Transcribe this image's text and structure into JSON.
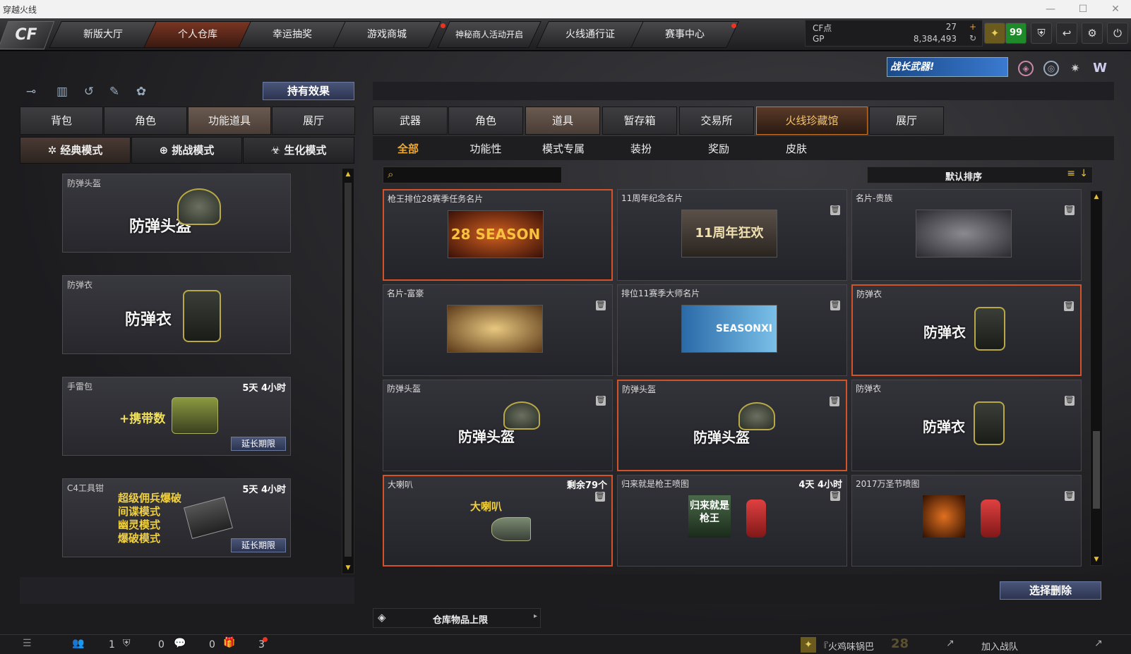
{
  "window": {
    "title": "穿越火线",
    "minimize": "—",
    "maximize": "☐",
    "close": "✕"
  },
  "nav": {
    "logo": "CF",
    "tabs": [
      "新版大厅",
      "个人仓库",
      "幸运抽奖",
      "游戏商城",
      "神秘商人活动开启",
      "火线通行证",
      "赛事中心"
    ],
    "active": "个人仓库"
  },
  "currency": {
    "cf_label": "CF点",
    "cf_value": "27",
    "gp_label": "GP",
    "gp_value": "8,384,493",
    "level": "99"
  },
  "banner": {
    "text": "战长武器!"
  },
  "left": {
    "effect_button": "持有效果",
    "tabs": [
      "背包",
      "角色",
      "功能道具",
      "展厅"
    ],
    "active_tab": "功能道具",
    "modes": [
      "经典模式",
      "挑战模式",
      "生化模式"
    ],
    "active_mode": "经典模式",
    "items": [
      {
        "name": "防弹头盔",
        "big": "防弹头盔",
        "time": "",
        "extend": ""
      },
      {
        "name": "防弹衣",
        "big": "防弹衣",
        "time": "",
        "extend": ""
      },
      {
        "name": "手雷包",
        "big": "+携带数",
        "time": "5天 4小时",
        "extend": "延长期限"
      },
      {
        "name": "C4工具钳",
        "big": "超级佣兵爆破\n间谍模式\n幽灵模式\n爆破模式",
        "time": "5天 4小时",
        "extend": "延长期限"
      }
    ],
    "c4_lines": [
      "超级佣兵爆破",
      "间谍模式",
      "幽灵模式",
      "爆破模式"
    ]
  },
  "right": {
    "tabs": [
      "武器",
      "角色",
      "道具",
      "暂存箱",
      "交易所",
      "火线珍藏馆",
      "展厅"
    ],
    "active_tab": "道具",
    "special_tab": "火线珍藏馆",
    "subtabs": [
      "全部",
      "功能性",
      "模式专属",
      "装扮",
      "奖励",
      "皮肤"
    ],
    "active_sub": "全部",
    "search_placeholder": "",
    "sort": "默认排序",
    "items": [
      {
        "name": "枪王排位28赛季任务名片",
        "time": "",
        "thumb": "28 SEASON",
        "sel": true,
        "del": false
      },
      {
        "name": "11周年纪念名片",
        "time": "",
        "thumb": "11周年狂欢",
        "sel": false,
        "del": true
      },
      {
        "name": "名片-贵族",
        "time": "",
        "thumb": "",
        "sel": false,
        "del": true
      },
      {
        "name": "名片-富豪",
        "time": "",
        "thumb": "",
        "sel": false,
        "del": true
      },
      {
        "name": "排位11赛季大师名片",
        "time": "",
        "thumb": "SEASONXI",
        "sel": false,
        "del": true
      },
      {
        "name": "防弹衣",
        "time": "",
        "thumb": "防弹衣",
        "sel": true,
        "del": true
      },
      {
        "name": "防弹头盔",
        "time": "",
        "thumb": "防弹头盔",
        "sel": false,
        "del": true
      },
      {
        "name": "防弹头盔",
        "time": "",
        "thumb": "防弹头盔",
        "sel": true,
        "del": true
      },
      {
        "name": "防弹衣",
        "time": "",
        "thumb": "防弹衣",
        "sel": false,
        "del": true
      },
      {
        "name": "大喇叭",
        "time": "剩余79个",
        "thumb": "大喇叭",
        "sel": true,
        "del": true
      },
      {
        "name": "归来就是枪王喷图",
        "time": "4天 4小时",
        "thumb": "归来就是枪王",
        "sel": false,
        "del": true
      },
      {
        "name": "2017万圣节喷图",
        "time": "",
        "thumb": "",
        "sel": false,
        "del": true
      }
    ],
    "delete_button": "选择删除",
    "capacity": "仓库物品上限"
  },
  "bottom": {
    "count1": "1",
    "count2": "0",
    "count3": "0",
    "count4": "3",
    "clan_name": "『火鸡味锅巴",
    "clan_num": "28",
    "join": "加入战队"
  }
}
